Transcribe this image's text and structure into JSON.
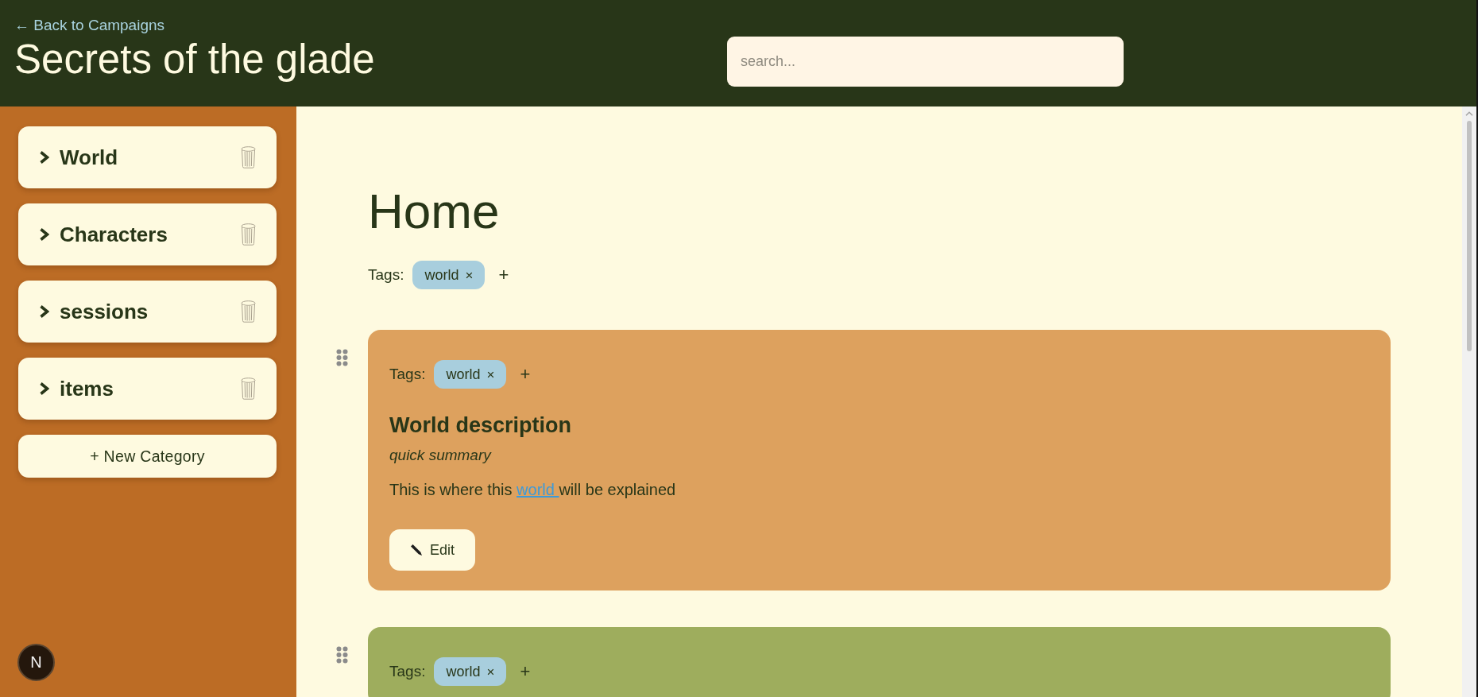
{
  "header": {
    "back_link": "← Back to Campaigns",
    "title": "Secrets of the glade",
    "search": {
      "placeholder": "search..."
    }
  },
  "sidebar": {
    "categories": [
      {
        "label": "World",
        "expanded": false
      },
      {
        "label": "Characters",
        "expanded": false
      },
      {
        "label": "sessions",
        "expanded": false
      },
      {
        "label": "items",
        "expanded": false
      }
    ],
    "new_category": "+ New Category",
    "dev_badge": "N"
  },
  "page": {
    "title": "Home",
    "tags": {
      "label": "Tags:",
      "items": [
        {
          "label": "world",
          "remove": "×"
        }
      ],
      "add": "+"
    }
  },
  "blocks": [
    {
      "color": "#dda15e",
      "tags": {
        "label": "Tags:",
        "items": [
          {
            "label": "world",
            "remove": "×"
          }
        ],
        "add": "+"
      },
      "title": "World description",
      "summary": "quick summary",
      "body": [
        {
          "kind": "text",
          "text": "This is where this "
        },
        {
          "kind": "link",
          "text": "world "
        },
        {
          "kind": "text",
          "text": "will be explained"
        }
      ],
      "edit_button": "Edit"
    },
    {
      "color": "#9ead5d",
      "tags": {
        "label": "Tags:",
        "items": [
          {
            "label": "world",
            "remove": "×"
          }
        ],
        "add": "+"
      }
    }
  ]
}
